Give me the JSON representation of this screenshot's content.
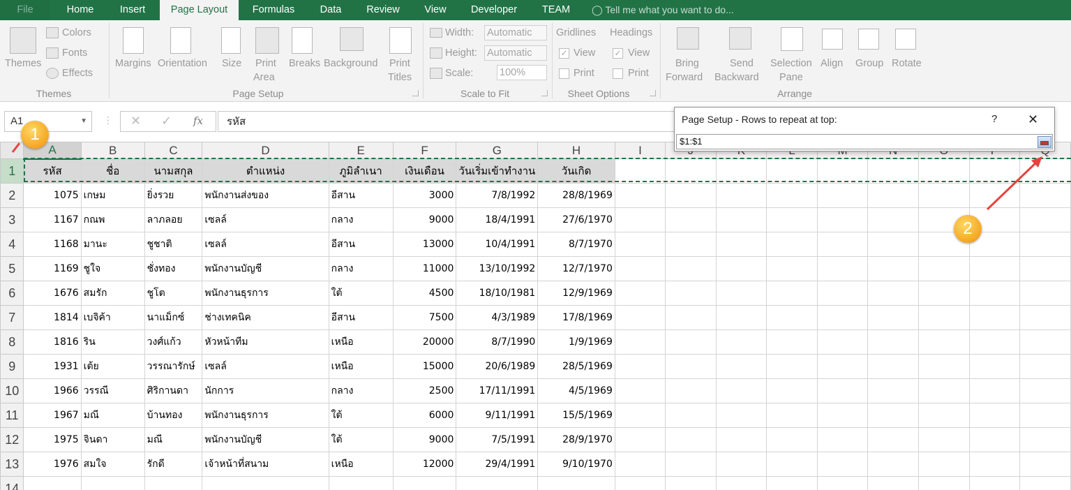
{
  "tabs": [
    "File",
    "Home",
    "Insert",
    "Page Layout",
    "Formulas",
    "Data",
    "Review",
    "View",
    "Developer",
    "TEAM"
  ],
  "tell_me": "Tell me what you want to do...",
  "ribbon": {
    "themes": {
      "big": "Themes",
      "colors": "Colors",
      "fonts": "Fonts",
      "effects": "Effects",
      "group": "Themes"
    },
    "page_setup": {
      "margins": "Margins",
      "orientation": "Orientation",
      "size": "Size",
      "print_area_1": "Print",
      "print_area_2": "Area",
      "breaks": "Breaks",
      "background": "Background",
      "print_titles_1": "Print",
      "print_titles_2": "Titles",
      "group": "Page Setup"
    },
    "scale": {
      "width": "Width:",
      "height": "Height:",
      "scale": "Scale:",
      "width_val": "Automatic",
      "height_val": "Automatic",
      "scale_val": "100%",
      "group": "Scale to Fit"
    },
    "sheet_options": {
      "gridlines": "Gridlines",
      "headings": "Headings",
      "view": "View",
      "print": "Print",
      "group": "Sheet Options"
    },
    "arrange": {
      "bring_1": "Bring",
      "bring_2": "Forward",
      "send_1": "Send",
      "send_2": "Backward",
      "sel_1": "Selection",
      "sel_2": "Pane",
      "align": "Align",
      "group_btn": "Group",
      "rotate": "Rotate",
      "group": "Arrange"
    }
  },
  "name_box": "A1",
  "formula": "รหัส",
  "dialog": {
    "title": "Page Setup - Rows to repeat at top:",
    "help": "?",
    "value": "$1:$1"
  },
  "columns": [
    "A",
    "B",
    "C",
    "D",
    "E",
    "F",
    "G",
    "H",
    "I",
    "J",
    "K",
    "L",
    "M",
    "N",
    "O",
    "P",
    "Q"
  ],
  "header_row": [
    "รหัส",
    "ชื่อ",
    "นามสกุล",
    "ตำแหน่ง",
    "ภูมิลำเนา",
    "เงินเดือน",
    "วันเริ่มเข้าทำงาน",
    "วันเกิด"
  ],
  "rows": [
    [
      "1075",
      "เกษม",
      "ยิ่งรวย",
      "พนักงานส่งของ",
      "อีสาน",
      "3000",
      "7/8/1992",
      "28/8/1969"
    ],
    [
      "1167",
      "กณพ",
      "ลาภลอย",
      "เซลล์",
      "กลาง",
      "9000",
      "18/4/1991",
      "27/6/1970"
    ],
    [
      "1168",
      "มานะ",
      "ชูชาติ",
      "เซลล์",
      "อีสาน",
      "13000",
      "10/4/1991",
      "8/7/1970"
    ],
    [
      "1169",
      "ชูใจ",
      "ชั่งทอง",
      "พนักงานบัญชี",
      "กลาง",
      "11000",
      "13/10/1992",
      "12/7/1970"
    ],
    [
      "1676",
      "สมรัก",
      "ชูโต",
      "พนักงานธุรการ",
      "ใต้",
      "4500",
      "18/10/1981",
      "12/9/1969"
    ],
    [
      "1814",
      "เบจิค้า",
      "นาแม็กซ์",
      "ช่างเทคนิค",
      "อีสาน",
      "7500",
      "4/3/1989",
      "17/8/1969"
    ],
    [
      "1816",
      "ริน",
      "วงศ์แก้ว",
      "หัวหน้าทีม",
      "เหนือ",
      "20000",
      "8/7/1990",
      "1/9/1969"
    ],
    [
      "1931",
      "เต้ย",
      "วรรณารักษ์",
      "เซลล์",
      "เหนือ",
      "15000",
      "20/6/1989",
      "28/5/1969"
    ],
    [
      "1966",
      "วรรณี",
      "ศิริกานดา",
      "นักการ",
      "กลาง",
      "2500",
      "17/11/1991",
      "4/5/1969"
    ],
    [
      "1967",
      "มณี",
      "บ้านทอง",
      "พนักงานธุรการ",
      "ใต้",
      "6000",
      "9/11/1991",
      "15/5/1969"
    ],
    [
      "1975",
      "จินดา",
      "มณี",
      "พนักงานบัญชี",
      "ใต้",
      "9000",
      "7/5/1991",
      "28/9/1970"
    ],
    [
      "1976",
      "สมใจ",
      "รักดี",
      "เจ้าหน้าที่สนาม",
      "เหนือ",
      "12000",
      "29/4/1991",
      "9/10/1970"
    ]
  ],
  "row_numbers": [
    "1",
    "2",
    "3",
    "4",
    "5",
    "6",
    "7",
    "8",
    "9",
    "10",
    "11",
    "12",
    "13",
    "14"
  ],
  "callouts": [
    "1",
    "2"
  ]
}
